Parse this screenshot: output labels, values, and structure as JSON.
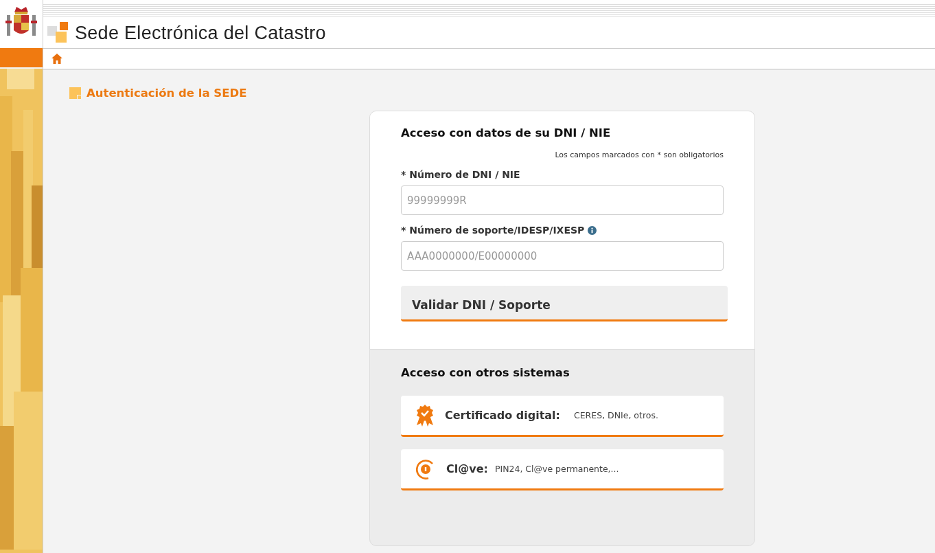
{
  "header": {
    "title": "Sede Electrónica del Catastro"
  },
  "page": {
    "heading": "Autenticación de la SEDE"
  },
  "dni_section": {
    "title": "Acceso con datos de su DNI / NIE",
    "required_note": "Los campos marcados con * son obligatorios",
    "fields": [
      {
        "label": "* Número de DNI / NIE",
        "placeholder": "99999999R",
        "info": false
      },
      {
        "label": "* Número de soporte/IDESP/IXESP",
        "placeholder": "AAA0000000/E00000000",
        "info": true
      }
    ],
    "button": "Validar DNI / Soporte"
  },
  "other_section": {
    "title": "Acceso con otros sistemas",
    "options": [
      {
        "kind": "certificate",
        "name": "Certificado digital:",
        "detail": "CERES, DNIe, otros."
      },
      {
        "kind": "clave",
        "name": "Cl@ve:",
        "detail": "PIN24, Cl@ve permanente,..."
      }
    ]
  }
}
